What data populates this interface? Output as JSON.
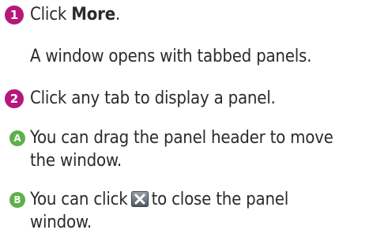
{
  "steps": [
    {
      "badge": "1",
      "text_pre": "Click ",
      "text_bold": "More",
      "text_post": "."
    },
    {
      "badge": "2",
      "text": "Click any tab to display a panel."
    }
  ],
  "step1_result": "A window opens with tabbed panels.",
  "notes": [
    {
      "badge": "A",
      "line1": "You can drag the panel header to move",
      "line2": "the window."
    },
    {
      "badge": "B",
      "line1_pre": "You can click",
      "line1_post": "to close the panel",
      "line2": "window.",
      "icon": "close-icon"
    }
  ],
  "colors": {
    "step_badge": "#b5177a",
    "note_badge": "#5db14a",
    "text": "#2b2b2b"
  }
}
